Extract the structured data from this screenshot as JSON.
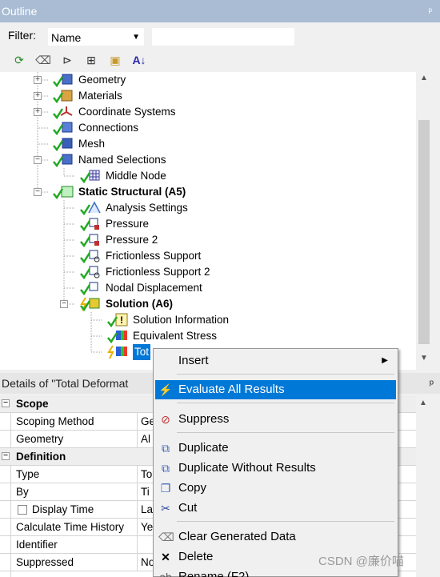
{
  "panel": {
    "title": "Outline",
    "pin": "ᵖ"
  },
  "filter": {
    "label": "Filter:",
    "selected": "Name",
    "text_value": ""
  },
  "tree": [
    {
      "label": "Geometry",
      "bold": false
    },
    {
      "label": "Materials",
      "bold": false
    },
    {
      "label": "Coordinate Systems",
      "bold": false
    },
    {
      "label": "Connections",
      "bold": false
    },
    {
      "label": "Mesh",
      "bold": false
    },
    {
      "label": "Named Selections",
      "bold": false
    },
    {
      "label": "Middle Node",
      "bold": false
    },
    {
      "label": "Static Structural (A5)",
      "bold": true
    },
    {
      "label": "Analysis Settings",
      "bold": false
    },
    {
      "label": "Pressure",
      "bold": false
    },
    {
      "label": "Pressure 2",
      "bold": false
    },
    {
      "label": "Frictionless Support",
      "bold": false
    },
    {
      "label": "Frictionless Support 2",
      "bold": false
    },
    {
      "label": "Nodal Displacement",
      "bold": false
    },
    {
      "label": "Solution (A6)",
      "bold": true
    },
    {
      "label": "Solution Information",
      "bold": false
    },
    {
      "label": "Equivalent Stress",
      "bold": false
    },
    {
      "label": "Tot",
      "bold": false
    }
  ],
  "details_title": "Details of \"Total Deformat",
  "details": {
    "scope_header": "Scope",
    "scoping_method": {
      "k": "Scoping Method",
      "v": "Ge"
    },
    "geometry": {
      "k": "Geometry",
      "v": "Al"
    },
    "definition_header": "Definition",
    "type": {
      "k": "Type",
      "v": "To"
    },
    "by": {
      "k": "By",
      "v": "Ti"
    },
    "display_time": {
      "k": "Display Time",
      "v": "La"
    },
    "calc_time_history": {
      "k": "Calculate Time History",
      "v": "Ye"
    },
    "identifier": {
      "k": "Identifier",
      "v": ""
    },
    "suppressed": {
      "k": "Suppressed",
      "v": "No"
    }
  },
  "menu": {
    "insert": "Insert",
    "evaluate": "Evaluate All Results",
    "suppress": "Suppress",
    "duplicate": "Duplicate",
    "duplicate_wo": "Duplicate Without Results",
    "copy": "Copy",
    "cut": "Cut",
    "clear": "Clear Generated Data",
    "delete": "Delete",
    "rename": "Rename (F2)"
  },
  "watermark": "CSDN @廉价喵",
  "colors": {
    "title_bg": "#a9bcd3",
    "highlight": "#0078d7",
    "check_green": "#22a822"
  }
}
